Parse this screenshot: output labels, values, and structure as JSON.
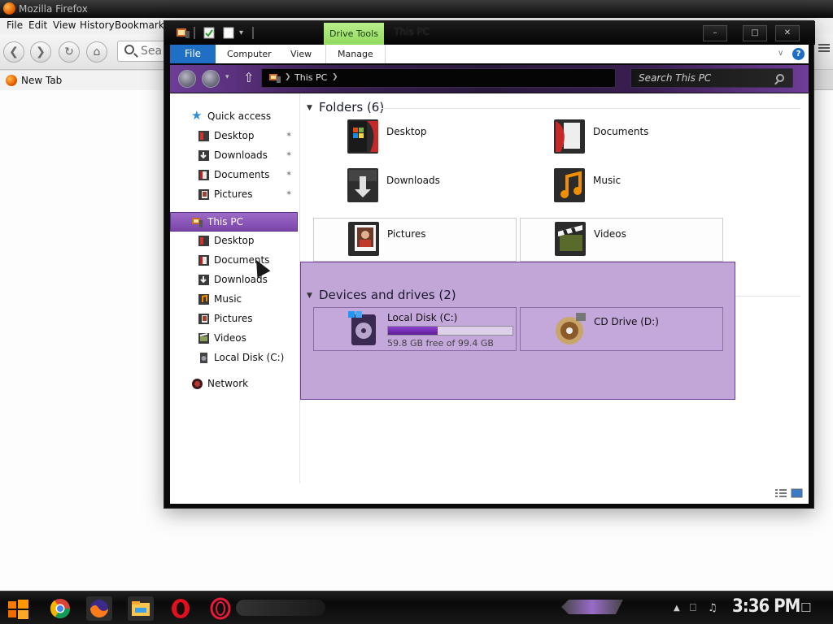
{
  "firefox": {
    "title": "Mozilla Firefox",
    "menu": [
      "File",
      "Edit",
      "View",
      "History",
      "Bookmarks"
    ],
    "search_placeholder": "Sea",
    "tab_label": "New Tab"
  },
  "explorer": {
    "window_title": "This PC",
    "contextual_tab": "Drive Tools",
    "ribbon_tabs": [
      "File",
      "Computer",
      "View",
      "Manage"
    ],
    "address_path": "This PC",
    "search_placeholder": "Search This PC",
    "nav": {
      "quick_access": "Quick access",
      "quick_items": [
        "Desktop",
        "Downloads",
        "Documents",
        "Pictures"
      ],
      "this_pc": "This PC",
      "pc_items": [
        "Desktop",
        "Documents",
        "Downloads",
        "Music",
        "Pictures",
        "Videos",
        "Local Disk (C:)"
      ],
      "network": "Network"
    },
    "folders_header": "Folders (6)",
    "folders": [
      "Desktop",
      "Documents",
      "Downloads",
      "Music",
      "Pictures",
      "Videos"
    ],
    "devices_header": "Devices and drives (2)",
    "drives": [
      {
        "label": "Local Disk (C:)",
        "free_text": "59.8 GB free of 99.4 GB",
        "used_fraction": 0.398
      },
      {
        "label": "CD Drive (D:)"
      }
    ]
  },
  "taskbar": {
    "clock": "3:36 PM",
    "apps": [
      "chrome-icon",
      "firefox-icon",
      "file-explorer-icon",
      "opera-icon",
      "opera-gx-icon"
    ]
  },
  "colors": {
    "accent_purple": "#7b44aa",
    "ribbon_file_blue": "#1f6fc7",
    "drive_tools_green": "#9ade6a",
    "selection_overlay": "#8b54b2"
  }
}
